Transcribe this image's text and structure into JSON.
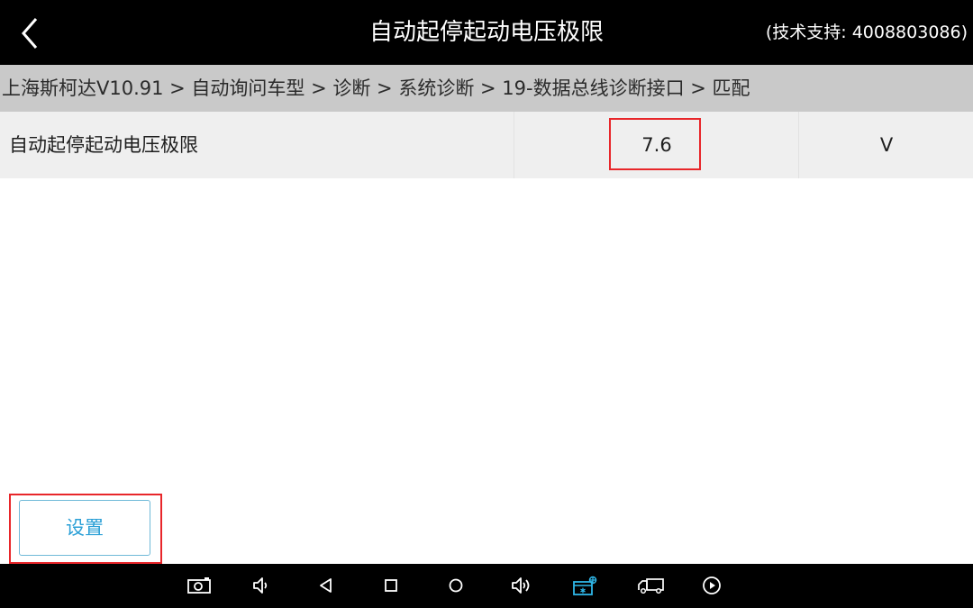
{
  "header": {
    "title": "自动起停起动电压极限",
    "support": "(技术支持: 4008803086)",
    "back_icon": "chevron-left-icon"
  },
  "breadcrumb": "上海斯柯达V10.91 > 自动询问车型 > 诊断 > 系统诊断 > 19-数据总线诊断接口 > 匹配",
  "table": {
    "rows": [
      {
        "name": "自动起停起动电压极限",
        "value": "7.6",
        "unit": "V"
      }
    ]
  },
  "actions": {
    "settings_label": "设置"
  },
  "annotations": {
    "highlight_color": "#e8262a"
  },
  "navbar": {
    "icons": [
      "screenshot-icon",
      "volume-down-icon",
      "back-triangle-icon",
      "recent-apps-icon",
      "home-circle-icon",
      "volume-up-icon",
      "vci-connection-icon",
      "truck-icon",
      "play-icon"
    ],
    "active_icon": "vci-connection-icon",
    "active_color": "#2fb7e8"
  }
}
